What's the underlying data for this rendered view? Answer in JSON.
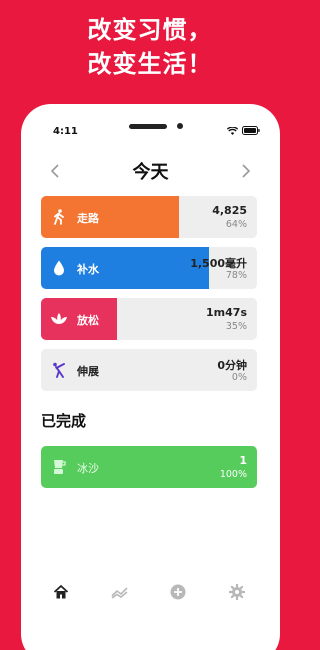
{
  "promo": {
    "line1": "改变习惯，",
    "line2": "改变生活！"
  },
  "colors": {
    "background": "#E8183F",
    "walk": "#F47532",
    "water": "#1E7FE0",
    "relax": "#E8325E",
    "stretch": "#5A36C9",
    "done": "#55CC5C"
  },
  "status_bar": {
    "time": "4:11"
  },
  "header": {
    "title": "今天",
    "prev_icon": "chevron-left-icon",
    "next_icon": "chevron-right-icon"
  },
  "habits": [
    {
      "name": "走路",
      "value": "4,825",
      "percent": "64%",
      "progress": 0.64,
      "icon": "walking-person-icon"
    },
    {
      "name": "补水",
      "value": "1,500毫升",
      "percent": "78%",
      "progress": 0.78,
      "icon": "water-drop-icon"
    },
    {
      "name": "放松",
      "value": "1m47s",
      "percent": "35%",
      "progress": 0.35,
      "icon": "lotus-icon"
    },
    {
      "name": "伸展",
      "value": "0分钟",
      "percent": "0%",
      "progress": 0.0,
      "icon": "stretching-person-icon"
    }
  ],
  "completed": {
    "title": "已完成",
    "items": [
      {
        "name": "冰沙",
        "value": "1",
        "percent": "100%",
        "progress": 1.0,
        "icon": "blender-icon"
      }
    ]
  },
  "tabbar": {
    "items": [
      "home-icon",
      "trend-icon",
      "add-circle-icon",
      "gear-icon"
    ],
    "active": "home-icon"
  }
}
